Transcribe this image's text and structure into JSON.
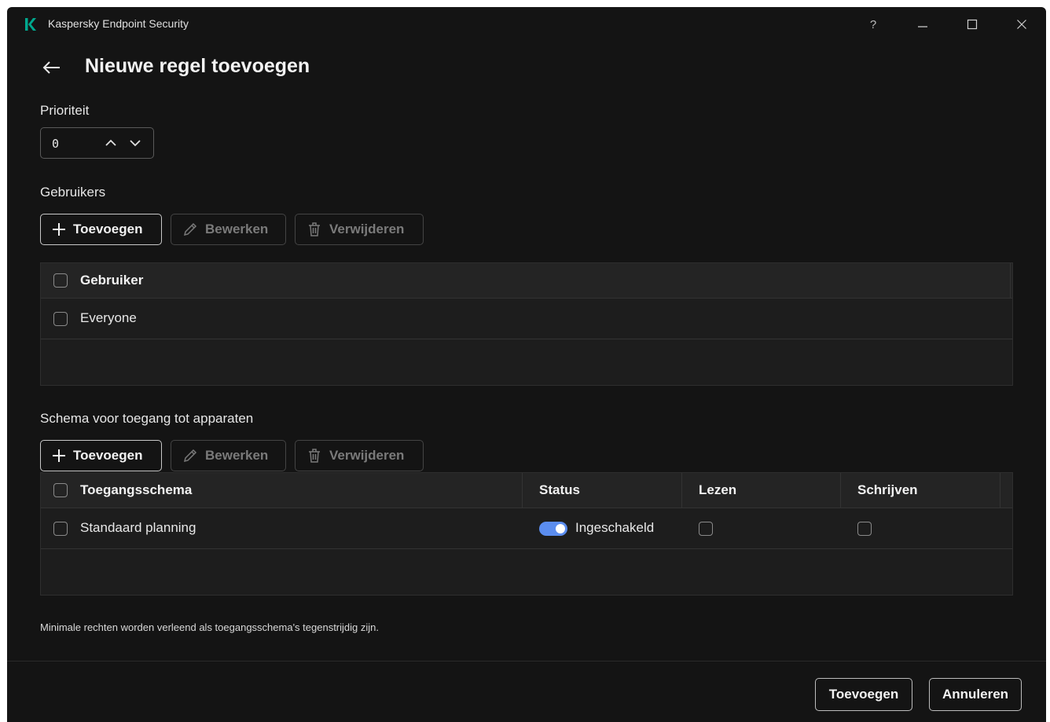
{
  "window": {
    "app_title": "Kaspersky Endpoint Security",
    "help_glyph": "?",
    "controls": [
      "minimize-icon",
      "maximize-icon",
      "close-icon"
    ]
  },
  "page": {
    "title": "Nieuwe regel toevoegen"
  },
  "priority": {
    "label": "Prioriteit",
    "value": "0"
  },
  "users": {
    "label": "Gebruikers",
    "toolbar": {
      "add": "Toevoegen",
      "edit": "Bewerken",
      "delete": "Verwijderen"
    },
    "columns": [
      "Gebruiker"
    ],
    "rows": [
      {
        "name": "Everyone"
      }
    ]
  },
  "schedules": {
    "label": "Schema voor toegang tot apparaten",
    "toolbar": {
      "add": "Toevoegen",
      "edit": "Bewerken",
      "delete": "Verwijderen"
    },
    "columns": [
      "Toegangsschema",
      "Status",
      "Lezen",
      "Schrijven"
    ],
    "rows": [
      {
        "name": "Standaard planning",
        "status": "Ingeschakeld",
        "status_on": true,
        "read": false,
        "write": false
      }
    ]
  },
  "note": "Minimale rechten worden verleend als toegangsschema's tegenstrijdig zijn.",
  "footer": {
    "add": "Toevoegen",
    "cancel": "Annuleren"
  },
  "colors": {
    "background": "#141414",
    "accent": "#5b8def",
    "logo": "#00a88e"
  }
}
